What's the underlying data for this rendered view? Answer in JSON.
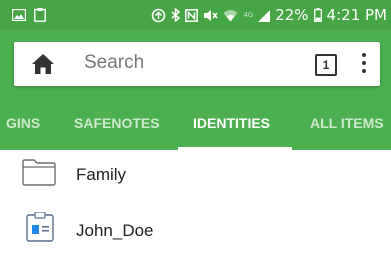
{
  "status_bar": {
    "icons_left": [
      "image-icon",
      "clipboard-icon"
    ],
    "icons_right": [
      "sync-icon",
      "bluetooth-icon",
      "nfc-icon",
      "mute-icon",
      "wifi-icon",
      "lte-signal-icon"
    ],
    "lte_label": "4G",
    "battery": "22%",
    "time": "4:21 PM"
  },
  "search": {
    "placeholder": "Search",
    "tab_count": "1"
  },
  "tabs": [
    {
      "label": "GINS",
      "active": false
    },
    {
      "label": "SAFENOTES",
      "active": false
    },
    {
      "label": "IDENTITIES",
      "active": true
    },
    {
      "label": "ALL ITEMS",
      "active": false
    }
  ],
  "items": [
    {
      "label": "Family",
      "icon": "folder-icon"
    },
    {
      "label": "John_Doe",
      "icon": "identity-card-icon"
    }
  ],
  "colors": {
    "status_bar": "#46a544",
    "app_bar": "#4caf50",
    "identity_blue": "#1e88e5"
  }
}
